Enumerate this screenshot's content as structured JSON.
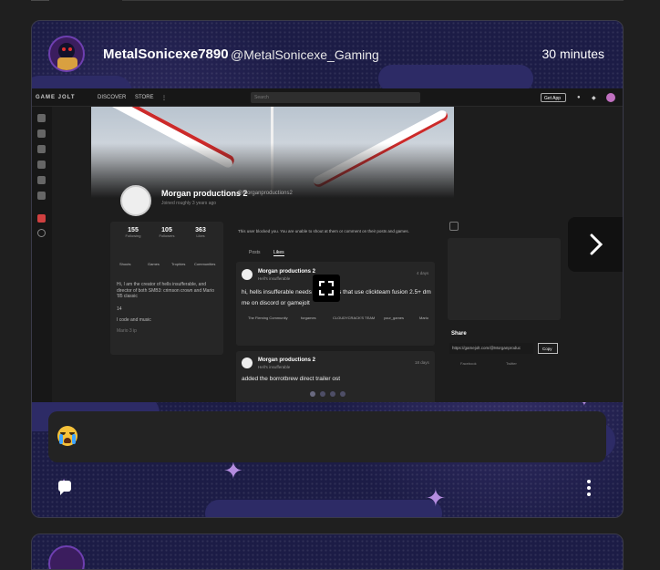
{
  "post": {
    "username": "MetalSonicexe7890",
    "handle": "@MetalSonicexe_Gaming",
    "time": "30 minutes",
    "comment_emoji": "loudly-crying-face-emoji"
  },
  "screenshot": {
    "nav": {
      "logo": "GAME JOLT",
      "discover": "DISCOVER",
      "store": "STORE",
      "search_placeholder": "Search",
      "get_app": "Get App"
    },
    "profile": {
      "name": "Morgan productions 2",
      "handle": "@Morganproductions2",
      "joined": "Joined roughly 3 years ago",
      "stats": [
        {
          "value": "155",
          "label": "Following"
        },
        {
          "value": "105",
          "label": "Followers"
        },
        {
          "value": "363",
          "label": "Likes"
        }
      ],
      "nav_items": [
        "Shouts",
        "Games",
        "Trophies",
        "Communities"
      ],
      "bio": "Hi, I am the creator of hells insufferable, and director of both SMB3: crimson crown and Mario '85 classic",
      "age": "14",
      "interests": "I code and music",
      "more": "Mario 3 ip",
      "blocked": "This user blocked you. You are unable to shout at them or comment on their posts and games.",
      "tabs": [
        "Posts",
        "Likes"
      ],
      "share_title": "Share",
      "share_url": "https://gamejolt.com/@Morganproduc",
      "copy": "Copy",
      "facebook": "Facebook",
      "twitter": "Twitter"
    },
    "posts": [
      {
        "author": "Morgan productions 2",
        "sub": "Hell's insufferable",
        "time": "4 days",
        "text": "hi, hells insufferable needs 2-3 coders that use clickteam fusion 2.5+ dm me on discord or gamejolt",
        "tags": [
          "The Fleming Community",
          "forgames",
          "CLOUDYCRACK'S TEAM",
          "your_games",
          "Mario"
        ]
      },
      {
        "author": "Morgan productions 2",
        "sub": "Hell's insufferable",
        "time": "18 days",
        "text": "added the borrotbrew direct trailer ost"
      }
    ]
  },
  "carousel": {
    "pages": 4,
    "active": 0
  }
}
